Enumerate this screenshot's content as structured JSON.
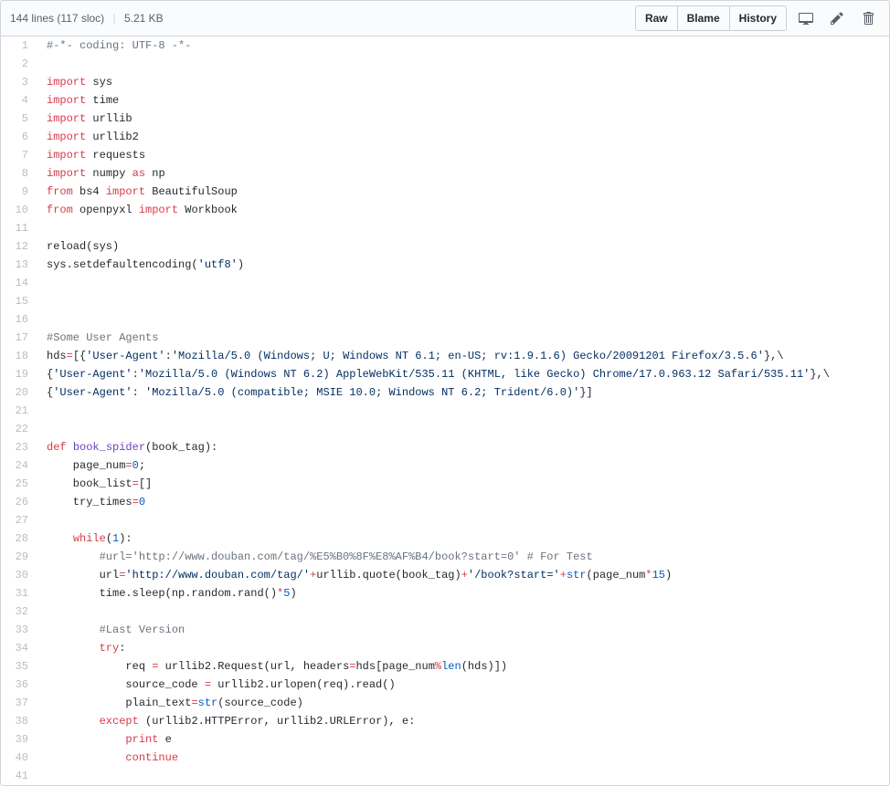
{
  "header": {
    "lines_info": "144 lines (117 sloc)",
    "size_info": "5.21 KB",
    "raw_label": "Raw",
    "blame_label": "Blame",
    "history_label": "History"
  },
  "code_lines": [
    {
      "n": 1,
      "tokens": [
        {
          "t": "#-*- coding: UTF-8 -*-",
          "c": "pl-c"
        }
      ]
    },
    {
      "n": 2,
      "tokens": []
    },
    {
      "n": 3,
      "tokens": [
        {
          "t": "import",
          "c": "pl-k"
        },
        {
          "t": " sys",
          "c": ""
        }
      ]
    },
    {
      "n": 4,
      "tokens": [
        {
          "t": "import",
          "c": "pl-k"
        },
        {
          "t": " time",
          "c": ""
        }
      ]
    },
    {
      "n": 5,
      "tokens": [
        {
          "t": "import",
          "c": "pl-k"
        },
        {
          "t": " urllib",
          "c": ""
        }
      ]
    },
    {
      "n": 6,
      "tokens": [
        {
          "t": "import",
          "c": "pl-k"
        },
        {
          "t": " urllib2",
          "c": ""
        }
      ]
    },
    {
      "n": 7,
      "tokens": [
        {
          "t": "import",
          "c": "pl-k"
        },
        {
          "t": " requests",
          "c": ""
        }
      ]
    },
    {
      "n": 8,
      "tokens": [
        {
          "t": "import",
          "c": "pl-k"
        },
        {
          "t": " numpy ",
          "c": ""
        },
        {
          "t": "as",
          "c": "pl-k"
        },
        {
          "t": " np",
          "c": ""
        }
      ]
    },
    {
      "n": 9,
      "tokens": [
        {
          "t": "from",
          "c": "pl-k"
        },
        {
          "t": " bs4 ",
          "c": ""
        },
        {
          "t": "import",
          "c": "pl-k"
        },
        {
          "t": " BeautifulSoup",
          "c": ""
        }
      ]
    },
    {
      "n": 10,
      "tokens": [
        {
          "t": "from",
          "c": "pl-k"
        },
        {
          "t": " openpyxl ",
          "c": ""
        },
        {
          "t": "import",
          "c": "pl-k"
        },
        {
          "t": " Workbook",
          "c": ""
        }
      ]
    },
    {
      "n": 11,
      "tokens": []
    },
    {
      "n": 12,
      "tokens": [
        {
          "t": "reload(sys)",
          "c": ""
        }
      ]
    },
    {
      "n": 13,
      "tokens": [
        {
          "t": "sys.setdefaultencoding(",
          "c": ""
        },
        {
          "t": "'utf8'",
          "c": "pl-s"
        },
        {
          "t": ")",
          "c": ""
        }
      ]
    },
    {
      "n": 14,
      "tokens": []
    },
    {
      "n": 15,
      "tokens": []
    },
    {
      "n": 16,
      "tokens": []
    },
    {
      "n": 17,
      "tokens": [
        {
          "t": "#Some User Agents",
          "c": "pl-c"
        }
      ]
    },
    {
      "n": 18,
      "tokens": [
        {
          "t": "hds",
          "c": ""
        },
        {
          "t": "=",
          "c": "pl-k"
        },
        {
          "t": "[{",
          "c": ""
        },
        {
          "t": "'User-Agent'",
          "c": "pl-s"
        },
        {
          "t": ":",
          "c": ""
        },
        {
          "t": "'Mozilla/5.0 (Windows; U; Windows NT 6.1; en-US; rv:1.9.1.6) Gecko/20091201 Firefox/3.5.6'",
          "c": "pl-s"
        },
        {
          "t": "},\\",
          "c": ""
        }
      ]
    },
    {
      "n": 19,
      "tokens": [
        {
          "t": "{",
          "c": ""
        },
        {
          "t": "'User-Agent'",
          "c": "pl-s"
        },
        {
          "t": ":",
          "c": ""
        },
        {
          "t": "'Mozilla/5.0 (Windows NT 6.2) AppleWebKit/535.11 (KHTML, like Gecko) Chrome/17.0.963.12 Safari/535.11'",
          "c": "pl-s"
        },
        {
          "t": "},\\",
          "c": ""
        }
      ]
    },
    {
      "n": 20,
      "tokens": [
        {
          "t": "{",
          "c": ""
        },
        {
          "t": "'User-Agent'",
          "c": "pl-s"
        },
        {
          "t": ": ",
          "c": ""
        },
        {
          "t": "'Mozilla/5.0 (compatible; MSIE 10.0; Windows NT 6.2; Trident/6.0)'",
          "c": "pl-s"
        },
        {
          "t": "}]",
          "c": ""
        }
      ]
    },
    {
      "n": 21,
      "tokens": []
    },
    {
      "n": 22,
      "tokens": []
    },
    {
      "n": 23,
      "tokens": [
        {
          "t": "def",
          "c": "pl-k"
        },
        {
          "t": " ",
          "c": ""
        },
        {
          "t": "book_spider",
          "c": "pl-en"
        },
        {
          "t": "(",
          "c": ""
        },
        {
          "t": "book_tag",
          "c": "pl-smi"
        },
        {
          "t": "):",
          "c": ""
        }
      ]
    },
    {
      "n": 24,
      "tokens": [
        {
          "t": "    page_num",
          "c": ""
        },
        {
          "t": "=",
          "c": "pl-k"
        },
        {
          "t": "0",
          "c": "pl-c1"
        },
        {
          "t": ";",
          "c": ""
        }
      ]
    },
    {
      "n": 25,
      "tokens": [
        {
          "t": "    book_list",
          "c": ""
        },
        {
          "t": "=",
          "c": "pl-k"
        },
        {
          "t": "[]",
          "c": ""
        }
      ]
    },
    {
      "n": 26,
      "tokens": [
        {
          "t": "    try_times",
          "c": ""
        },
        {
          "t": "=",
          "c": "pl-k"
        },
        {
          "t": "0",
          "c": "pl-c1"
        }
      ]
    },
    {
      "n": 27,
      "tokens": []
    },
    {
      "n": 28,
      "tokens": [
        {
          "t": "    ",
          "c": ""
        },
        {
          "t": "while",
          "c": "pl-k"
        },
        {
          "t": "(",
          "c": ""
        },
        {
          "t": "1",
          "c": "pl-c1"
        },
        {
          "t": "):",
          "c": ""
        }
      ]
    },
    {
      "n": 29,
      "tokens": [
        {
          "t": "        ",
          "c": ""
        },
        {
          "t": "#url='http://www.douban.com/tag/%E5%B0%8F%E8%AF%B4/book?start=0' # For Test",
          "c": "pl-c"
        }
      ]
    },
    {
      "n": 30,
      "tokens": [
        {
          "t": "        url",
          "c": ""
        },
        {
          "t": "=",
          "c": "pl-k"
        },
        {
          "t": "'http://www.douban.com/tag/'",
          "c": "pl-s"
        },
        {
          "t": "+",
          "c": "pl-k"
        },
        {
          "t": "urllib.quote(book_tag)",
          "c": ""
        },
        {
          "t": "+",
          "c": "pl-k"
        },
        {
          "t": "'/book?start='",
          "c": "pl-s"
        },
        {
          "t": "+",
          "c": "pl-k"
        },
        {
          "t": "str",
          "c": "pl-c1"
        },
        {
          "t": "(page_num",
          "c": ""
        },
        {
          "t": "*",
          "c": "pl-k"
        },
        {
          "t": "15",
          "c": "pl-c1"
        },
        {
          "t": ")",
          "c": ""
        }
      ]
    },
    {
      "n": 31,
      "tokens": [
        {
          "t": "        time.sleep(np.random.rand()",
          "c": ""
        },
        {
          "t": "*",
          "c": "pl-k"
        },
        {
          "t": "5",
          "c": "pl-c1"
        },
        {
          "t": ")",
          "c": ""
        }
      ]
    },
    {
      "n": 32,
      "tokens": []
    },
    {
      "n": 33,
      "tokens": [
        {
          "t": "        ",
          "c": ""
        },
        {
          "t": "#Last Version",
          "c": "pl-c"
        }
      ]
    },
    {
      "n": 34,
      "tokens": [
        {
          "t": "        ",
          "c": ""
        },
        {
          "t": "try",
          "c": "pl-k"
        },
        {
          "t": ":",
          "c": ""
        }
      ]
    },
    {
      "n": 35,
      "tokens": [
        {
          "t": "            req ",
          "c": ""
        },
        {
          "t": "=",
          "c": "pl-k"
        },
        {
          "t": " urllib2.Request(url, ",
          "c": ""
        },
        {
          "t": "headers",
          "c": "pl-smi"
        },
        {
          "t": "=",
          "c": "pl-k"
        },
        {
          "t": "hds[page_num",
          "c": ""
        },
        {
          "t": "%",
          "c": "pl-k"
        },
        {
          "t": "len",
          "c": "pl-c1"
        },
        {
          "t": "(hds)])",
          "c": ""
        }
      ]
    },
    {
      "n": 36,
      "tokens": [
        {
          "t": "            source_code ",
          "c": ""
        },
        {
          "t": "=",
          "c": "pl-k"
        },
        {
          "t": " urllib2.urlopen(req).read()",
          "c": ""
        }
      ]
    },
    {
      "n": 37,
      "tokens": [
        {
          "t": "            plain_text",
          "c": ""
        },
        {
          "t": "=",
          "c": "pl-k"
        },
        {
          "t": "str",
          "c": "pl-c1"
        },
        {
          "t": "(source_code)",
          "c": ""
        }
      ]
    },
    {
      "n": 38,
      "tokens": [
        {
          "t": "        ",
          "c": ""
        },
        {
          "t": "except",
          "c": "pl-k"
        },
        {
          "t": " (urllib2.HTTPError, urllib2.URLError), e:",
          "c": ""
        }
      ]
    },
    {
      "n": 39,
      "tokens": [
        {
          "t": "            ",
          "c": ""
        },
        {
          "t": "print",
          "c": "pl-k"
        },
        {
          "t": " e",
          "c": ""
        }
      ]
    },
    {
      "n": 40,
      "tokens": [
        {
          "t": "            ",
          "c": ""
        },
        {
          "t": "continue",
          "c": "pl-k"
        }
      ]
    },
    {
      "n": 41,
      "tokens": []
    }
  ]
}
